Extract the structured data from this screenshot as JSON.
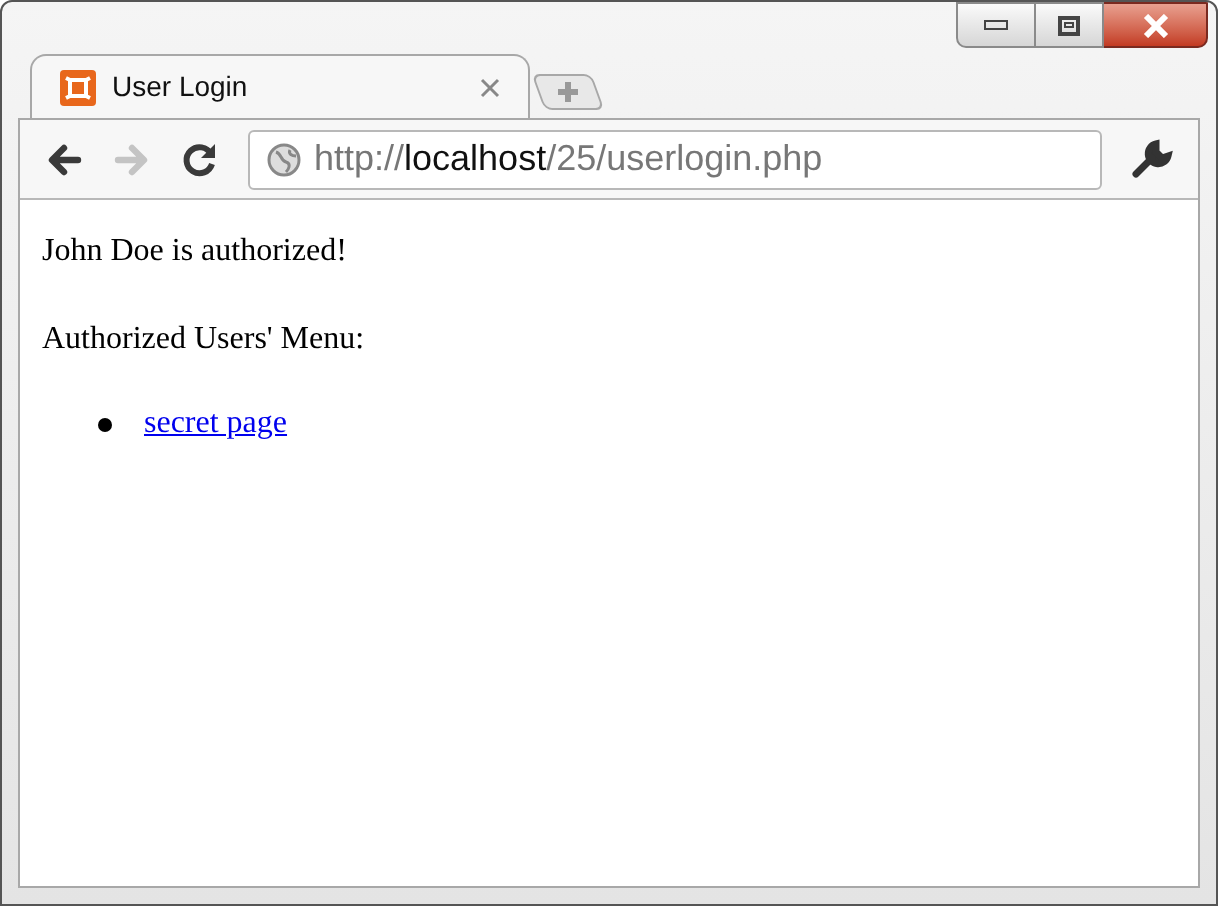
{
  "tab": {
    "title": "User Login",
    "selected": true
  },
  "toolbar": {
    "back_disabled": false,
    "forward_disabled": true
  },
  "address": {
    "parts": [
      {
        "text": "http://",
        "kind": "dim"
      },
      {
        "text": "localhost",
        "kind": "host"
      },
      {
        "text": "/25/userlogin.php",
        "kind": "dim"
      }
    ]
  },
  "page": {
    "message": "John Doe is authorized!",
    "menu_heading": "Authorized Users' Menu:",
    "links": [
      "secret page"
    ]
  }
}
